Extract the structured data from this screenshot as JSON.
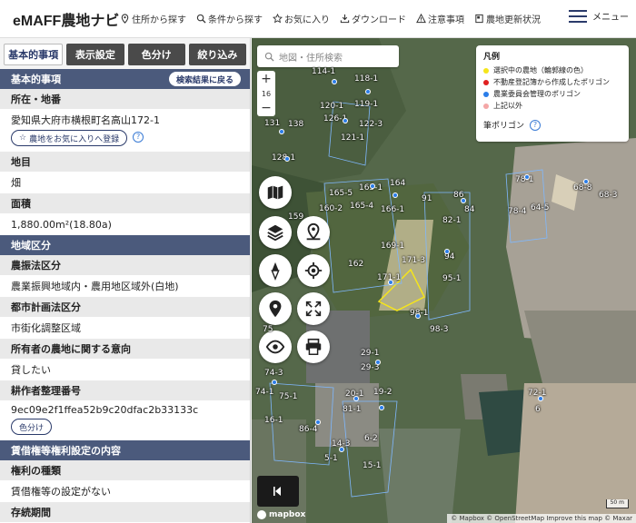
{
  "header": {
    "logo": "eMAFF農地ナビ",
    "nav": [
      {
        "label": "住所から探す",
        "icon": "location-pin-icon"
      },
      {
        "label": "条件から探す",
        "icon": "search-icon"
      },
      {
        "label": "お気に入り",
        "icon": "star-icon"
      },
      {
        "label": "ダウンロード",
        "icon": "download-icon"
      },
      {
        "label": "注意事項",
        "icon": "warning-icon"
      },
      {
        "label": "農地更新状況",
        "icon": "book-icon"
      }
    ],
    "menu_label": "メニュー"
  },
  "panel": {
    "tabs": [
      "基本的事項",
      "表示設定",
      "色分け",
      "絞り込み"
    ],
    "active_tab": "基本的事項",
    "basic_header": "基本的事項",
    "back_button": "検索結果に戻る",
    "address_label": "所在・地番",
    "address_value": "愛知県大府市横根町名高山172-1",
    "favorite_button": "農地をお気に入りへ登録",
    "chimoku_label": "地目",
    "chimoku_value": "畑",
    "area_label": "面積",
    "area_value": "1,880.00m²(18.80a)",
    "zoning_header": "地域区分",
    "noushin_label": "農振法区分",
    "noushin_value": "農業振興地域内・農用地区域外(白地)",
    "toshi_label": "都市計画法区分",
    "toshi_value": "市街化調整区域",
    "intention_label": "所有者の農地に関する意向",
    "intention_value": "貸したい",
    "farmer_label": "耕作者整理番号",
    "farmer_value": "9ec09e2f1ffea52b9c20dfac2b33133c",
    "color_button": "色分け",
    "lease_header": "賃借権等権利設定の内容",
    "right_type_label": "権利の種類",
    "right_type_value": "賃借権等の設定がない",
    "cut_label": "存続期間"
  },
  "map": {
    "search_placeholder": "地図・住所検索",
    "zoom_level": "16",
    "legend": {
      "title": "凡例",
      "items": [
        {
          "label": "選択中の農地（輪郭線の色）",
          "color": "#f5e51b"
        },
        {
          "label": "不動産登記簿から作成したポリゴン",
          "color": "#e02020"
        },
        {
          "label": "農業委員会管理のポリゴン",
          "color": "#2b7de9"
        },
        {
          "label": "上記以外",
          "color": "#f4a6a6"
        }
      ],
      "fude_label": "筆ポリゴン"
    },
    "mapbox_label": "mapbox",
    "attribution": "© Mapbox © OpenStreetMap Improve this map © Maxar",
    "scale": "50 m",
    "parcel_labels": [
      "114-1",
      "118-1",
      "120-1",
      "119-1",
      "126-1",
      "122-3",
      "121-1",
      "131",
      "138",
      "128-1",
      "165-5",
      "165-1",
      "164",
      "91",
      "86",
      "84",
      "82-1",
      "165-4",
      "166-1",
      "160-2",
      "159",
      "169-1",
      "162",
      "171-1",
      "171-3",
      "94",
      "95-1",
      "98-1",
      "98-3",
      "75",
      "78-1",
      "68-8",
      "68-3",
      "78-4",
      "64-5",
      "74-3",
      "74-1",
      "75-1",
      "20-1",
      "19-2",
      "81-1",
      "6-2",
      "14-3",
      "5-1",
      "72-1",
      "6",
      "86-4",
      "29-1",
      "29-3",
      "16-1",
      "15-1"
    ]
  }
}
